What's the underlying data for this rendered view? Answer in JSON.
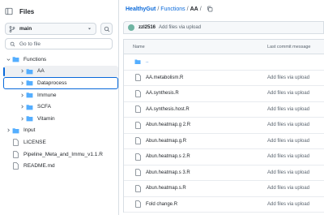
{
  "sidebar": {
    "title": "Files",
    "branch": "main",
    "goto_placeholder": "Go to file",
    "tree": [
      {
        "label": "Functions",
        "type": "folder",
        "open": true,
        "depth": 0
      },
      {
        "label": "AA",
        "type": "folder",
        "open": false,
        "depth": 1,
        "active": true
      },
      {
        "label": "Dataprocess",
        "type": "folder",
        "open": false,
        "depth": 1,
        "focused": true
      },
      {
        "label": "Immune",
        "type": "folder",
        "open": false,
        "depth": 1
      },
      {
        "label": "SCFA",
        "type": "folder",
        "open": false,
        "depth": 1
      },
      {
        "label": "Vitamin",
        "type": "folder",
        "open": false,
        "depth": 1
      },
      {
        "label": "Input",
        "type": "folder",
        "open": false,
        "depth": 0
      },
      {
        "label": "LICENSE",
        "type": "file",
        "depth": 0
      },
      {
        "label": "Pipeline_Meta_and_Immu_v1.1.R",
        "type": "file",
        "depth": 0
      },
      {
        "label": "README.md",
        "type": "file",
        "depth": 0
      }
    ]
  },
  "breadcrumb": {
    "repo": "HealthyGut",
    "sep1": "/",
    "folder": "Functions",
    "sep2": "/",
    "current": "AA",
    "sep3": "/"
  },
  "commit": {
    "user": "zzl2516",
    "message": "Add files via upload"
  },
  "table": {
    "col_name": "Name",
    "col_commit": "Last commit message",
    "parent": "..",
    "rows": [
      {
        "name": "AA.metabolism.R",
        "commit": "Add files via upload"
      },
      {
        "name": "AA.synthesis.R",
        "commit": "Add files via upload"
      },
      {
        "name": "AA.synthesis.host.R",
        "commit": "Add files via upload"
      },
      {
        "name": "Abun.heatmap.g 2.R",
        "commit": "Add files via upload"
      },
      {
        "name": "Abun.heatmap.g.R",
        "commit": "Add files via upload"
      },
      {
        "name": "Abun.heatmap.s 2.R",
        "commit": "Add files via upload"
      },
      {
        "name": "Abun.heatmap.s 3.R",
        "commit": "Add files via upload"
      },
      {
        "name": "Abun.heatmap.s.R",
        "commit": "Add files via upload"
      },
      {
        "name": "Fold change.R",
        "commit": "Add files via upload"
      }
    ]
  },
  "colors": {
    "accent": "#0969da",
    "folder": "#54aeff",
    "muted": "#59636e"
  },
  "icons": [
    "sidebar-collapse-icon",
    "branch-icon",
    "caret-down-icon",
    "search-icon",
    "chevron-icon",
    "folder-icon",
    "file-icon",
    "copy-icon",
    "avatar"
  ]
}
